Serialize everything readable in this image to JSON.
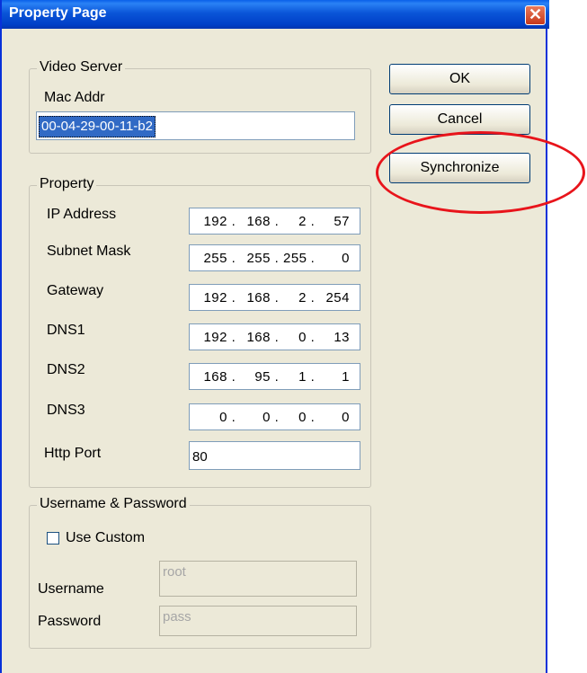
{
  "window": {
    "title": "Property Page",
    "close_glyph": "✕"
  },
  "buttons": {
    "ok": "OK",
    "cancel": "Cancel",
    "synchronize": "Synchronize"
  },
  "video_server": {
    "legend": "Video Server",
    "mac_label": "Mac Addr",
    "mac_value": "00-04-29-00-11-b2"
  },
  "property": {
    "legend": "Property",
    "fields": [
      {
        "label": "IP Address",
        "octets": [
          "192",
          "168",
          "2",
          "57"
        ]
      },
      {
        "label": "Subnet Mask",
        "octets": [
          "255",
          "255",
          "255",
          "0"
        ]
      },
      {
        "label": "Gateway",
        "octets": [
          "192",
          "168",
          "2",
          "254"
        ]
      },
      {
        "label": "DNS1",
        "octets": [
          "192",
          "168",
          "0",
          "13"
        ]
      },
      {
        "label": "DNS2",
        "octets": [
          "168",
          "95",
          "1",
          "1"
        ]
      },
      {
        "label": "DNS3",
        "octets": [
          "0",
          "0",
          "0",
          "0"
        ]
      }
    ],
    "http_port_label": "Http Port",
    "http_port_value": "80"
  },
  "credentials": {
    "legend": "Username & Password",
    "use_custom_label": "Use Custom",
    "use_custom_checked": false,
    "username_label": "Username",
    "username_value": "root",
    "password_label": "Password",
    "password_value": "pass"
  },
  "colors": {
    "highlight_ring": "#e8141b",
    "titlebar": "#0a55d8",
    "dialog_bg": "#ece9d8"
  }
}
